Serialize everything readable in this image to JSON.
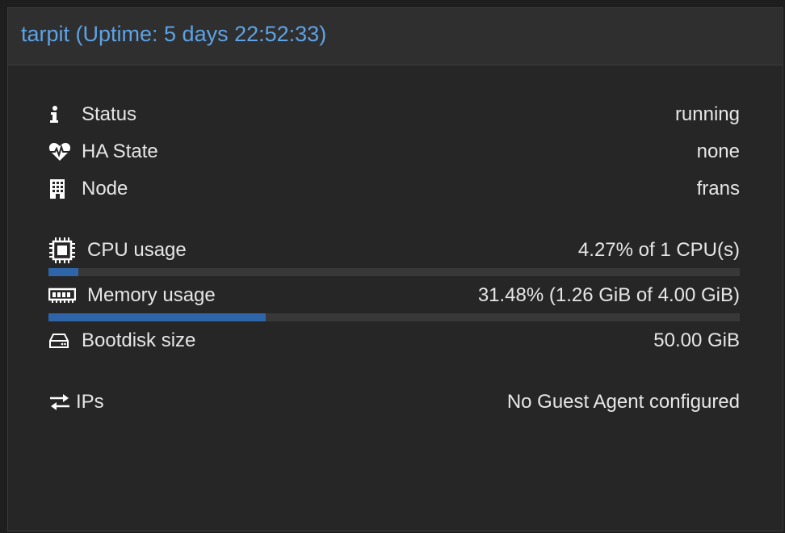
{
  "header": {
    "title": "tarpit (Uptime: 5 days 22:52:33)"
  },
  "status": {
    "label": "Status",
    "value": "running",
    "icon": "info-icon"
  },
  "ha_state": {
    "label": "HA State",
    "value": "none",
    "icon": "heartbeat-icon"
  },
  "node": {
    "label": "Node",
    "value": "frans",
    "icon": "building-icon"
  },
  "cpu": {
    "label": "CPU usage",
    "value": "4.27% of 1 CPU(s)",
    "icon": "cpu-icon",
    "bar_fraction": 0.0427
  },
  "memory": {
    "label": "Memory usage",
    "value": "31.48% (1.26 GiB of 4.00 GiB)",
    "icon": "memory-icon",
    "bar_fraction": 0.3148
  },
  "bootdisk": {
    "label": "Bootdisk size",
    "value": "50.00 GiB",
    "icon": "hdd-icon"
  },
  "ips": {
    "label": "IPs",
    "value": "No Guest Agent configured",
    "icon": "exchange-icon"
  },
  "colors": {
    "accent": "#5da3e6",
    "bar_fill": "#2d65a8",
    "bar_track": "#383838",
    "text": "#e6e6e6",
    "panel_bg": "#262626"
  }
}
